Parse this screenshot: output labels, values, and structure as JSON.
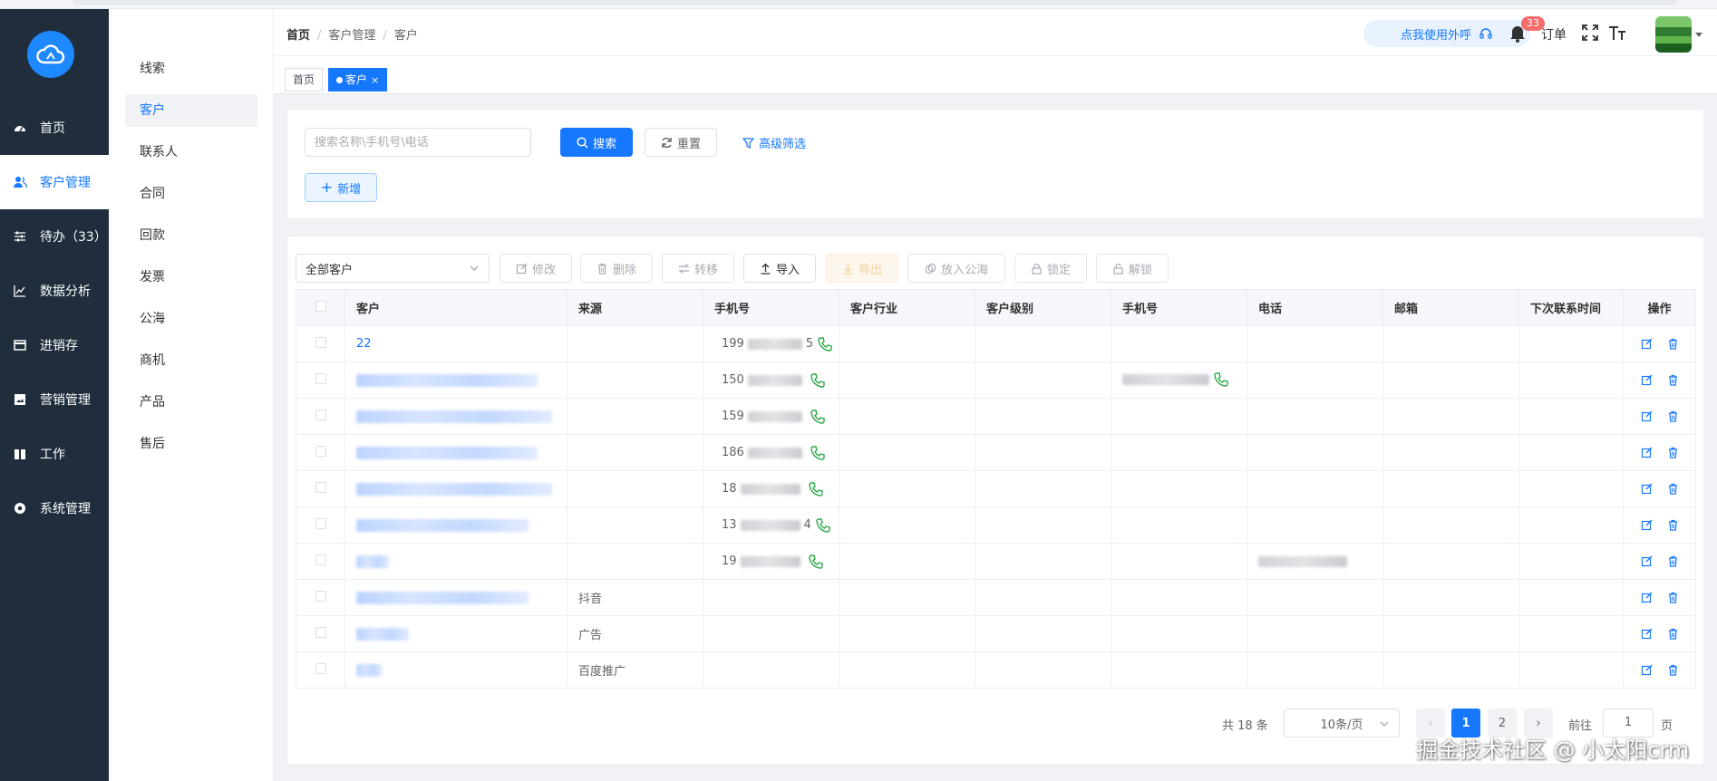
{
  "sidebar": {
    "items": [
      {
        "label": "首页",
        "icon": "dashboard-icon"
      },
      {
        "label": "客户管理",
        "icon": "users-icon"
      },
      {
        "label": "待办（33）",
        "icon": "sliders-icon"
      },
      {
        "label": "数据分析",
        "icon": "line-chart-icon"
      },
      {
        "label": "进销存",
        "icon": "window-icon"
      },
      {
        "label": "营销管理",
        "icon": "picture-icon"
      },
      {
        "label": "工作",
        "icon": "book-icon"
      },
      {
        "label": "系统管理",
        "icon": "gear-icon"
      }
    ],
    "active_index": 1
  },
  "submenu": {
    "items": [
      "线索",
      "客户",
      "联系人",
      "合同",
      "回款",
      "发票",
      "公海",
      "商机",
      "产品",
      "售后"
    ],
    "active_index": 1
  },
  "header": {
    "breadcrumb": [
      "首页",
      "客户管理",
      "客户"
    ],
    "call_label": "点我使用外呼",
    "badge_count": "33",
    "order_label": "订单"
  },
  "tabs": [
    {
      "label": "首页",
      "active": false
    },
    {
      "label": "客户",
      "active": true,
      "close": "×"
    }
  ],
  "search": {
    "placeholder": "搜索名称\\手机号\\电话",
    "search_label": "搜索",
    "reset_label": "重置",
    "advanced_label": "高级筛选",
    "add_label": "新增"
  },
  "toolbar": {
    "scope_select": "全部客户",
    "buttons": [
      {
        "label": "修改",
        "icon": "edit-icon"
      },
      {
        "label": "删除",
        "icon": "trash-icon"
      },
      {
        "label": "转移",
        "icon": "transfer-icon"
      },
      {
        "label": "导入",
        "icon": "upload-icon"
      },
      {
        "label": "导出",
        "icon": "download-icon"
      },
      {
        "label": "放入公海",
        "icon": "copy-icon"
      },
      {
        "label": "锁定",
        "icon": "lock-icon"
      },
      {
        "label": "解锁",
        "icon": "unlock-icon"
      }
    ]
  },
  "table": {
    "columns": [
      "客户",
      "来源",
      "手机号",
      "客户行业",
      "客户级别",
      "手机号",
      "电话",
      "邮箱",
      "下次联系时间",
      "操作"
    ],
    "rows": [
      {
        "customer": "22",
        "source": "",
        "mobile": "199",
        "mobile_suffix": "5",
        "has_call": true,
        "mobile2": false,
        "tel": false
      },
      {
        "customer": "",
        "source": "",
        "mobile": "150",
        "mobile_suffix": "",
        "has_call": true,
        "mobile2": true,
        "tel": false
      },
      {
        "customer": "",
        "source": "",
        "mobile": "159",
        "mobile_suffix": "",
        "has_call": true,
        "mobile2": false,
        "tel": false
      },
      {
        "customer": "",
        "source": "",
        "mobile": "186",
        "mobile_suffix": "",
        "has_call": true,
        "mobile2": false,
        "tel": false
      },
      {
        "customer": "",
        "source": "",
        "mobile": "18",
        "mobile_suffix": "",
        "has_call": true,
        "mobile2": false,
        "tel": false
      },
      {
        "customer": "",
        "source": "",
        "mobile": "13",
        "mobile_suffix": "4",
        "has_call": true,
        "mobile2": false,
        "tel": false
      },
      {
        "customer": "",
        "source": "",
        "mobile": "19",
        "mobile_suffix": "",
        "has_call": true,
        "mobile2": false,
        "tel": true
      },
      {
        "customer": "",
        "source": "抖音",
        "mobile": "",
        "mobile_suffix": "",
        "has_call": false,
        "mobile2": false,
        "tel": false
      },
      {
        "customer": "",
        "source": "广告",
        "mobile": "",
        "mobile_suffix": "",
        "has_call": false,
        "mobile2": false,
        "tel": false
      },
      {
        "customer": "",
        "source": "百度推广",
        "mobile": "",
        "mobile_suffix": "",
        "has_call": false,
        "mobile2": false,
        "tel": false
      }
    ]
  },
  "pagination": {
    "total": "共 18 条",
    "page_size": "10条/页",
    "pages": [
      "1",
      "2"
    ],
    "current": "1",
    "goto_label": "前往",
    "goto_value": "1",
    "goto_unit": "页",
    "prev": "‹",
    "next": "›"
  },
  "watermark": "掘金技术社区 @ 小太阳crm",
  "colors": {
    "primary": "#1677ff",
    "sidebar_bg": "#1f2d3d",
    "badge": "#f56c6c",
    "call_green": "#28a745"
  }
}
